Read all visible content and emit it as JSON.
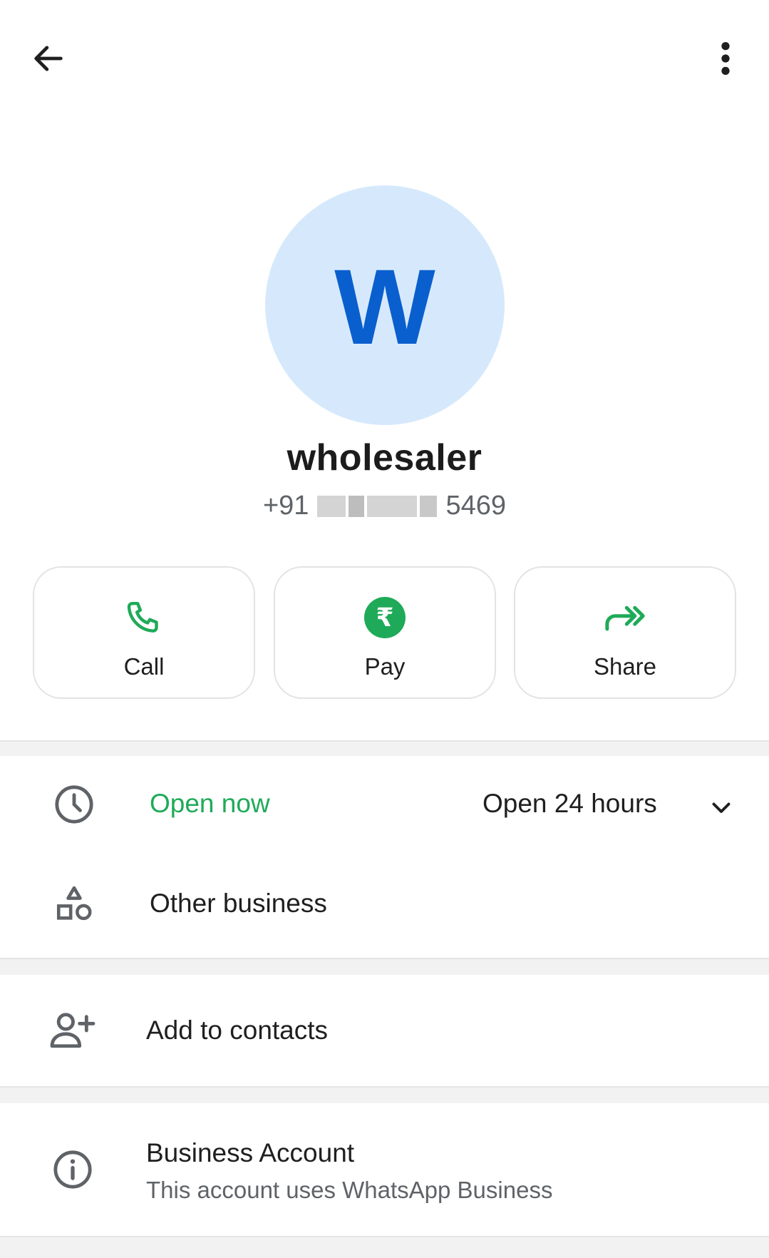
{
  "header": {
    "back_icon": "arrow-left-icon",
    "menu_icon": "more-vertical-icon"
  },
  "profile": {
    "avatar_letter": "W",
    "name": "wholesaler",
    "phone_prefix": "+91",
    "phone_suffix": "5469",
    "avatar_color": "#d6e9fc",
    "letter_color": "#0a5fcf"
  },
  "actions": [
    {
      "label": "Call",
      "icon": "phone-icon"
    },
    {
      "label": "Pay",
      "icon": "rupee-icon",
      "symbol": "₹"
    },
    {
      "label": "Share",
      "icon": "share-forward-icon"
    }
  ],
  "hours": {
    "status": "Open now",
    "detail": "Open 24 hours",
    "icon": "clock-icon",
    "expand_icon": "chevron-down-icon",
    "status_color": "#1faa59"
  },
  "category": {
    "label": "Other business",
    "icon": "shapes-icon"
  },
  "contacts": {
    "label": "Add to contacts",
    "icon": "person-add-icon"
  },
  "business_account": {
    "title": "Business Account",
    "subtitle": "This account uses WhatsApp Business",
    "icon": "info-icon"
  }
}
